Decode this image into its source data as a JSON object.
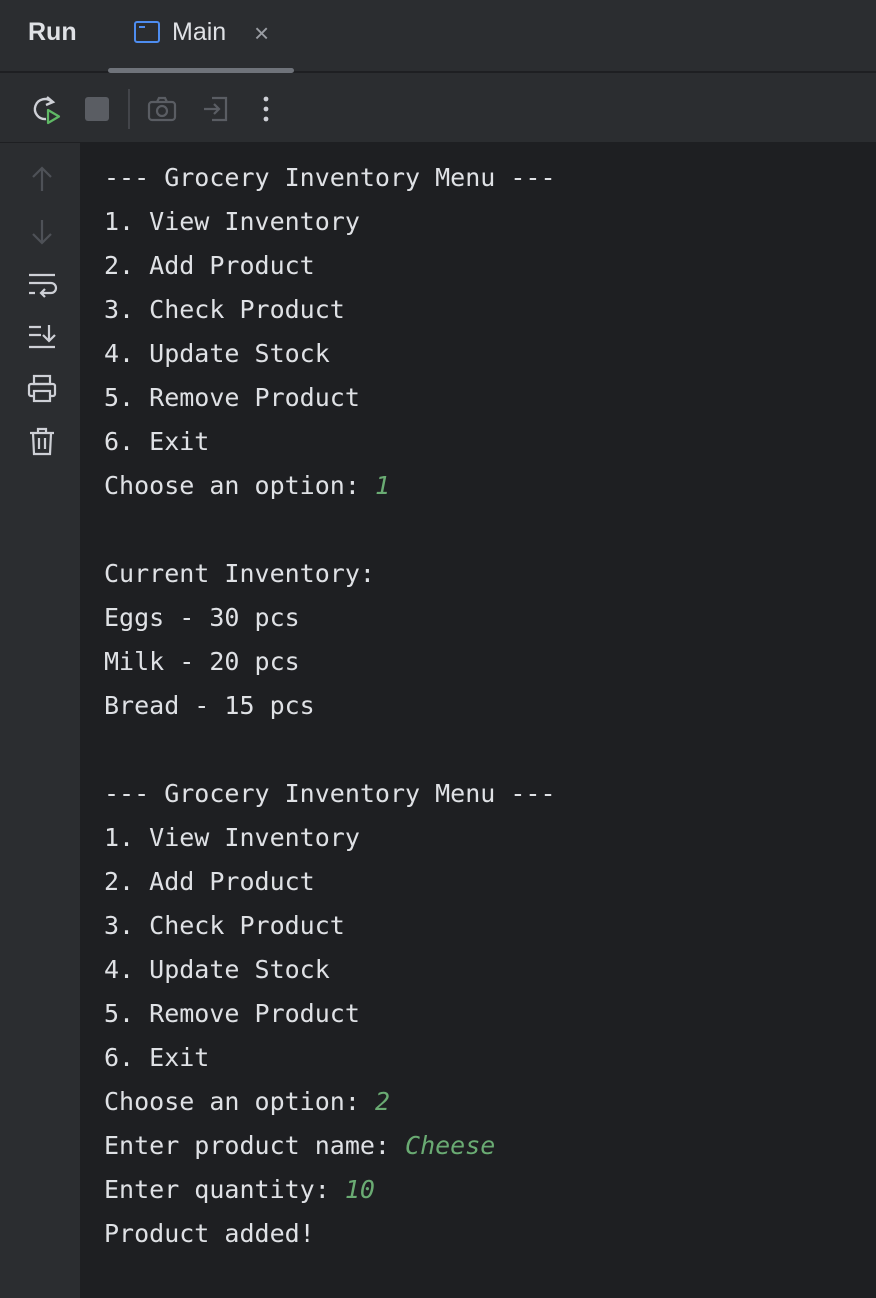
{
  "header": {
    "run_title": "Run",
    "tab_label": "Main",
    "tab_close": "×"
  },
  "toolbar": {
    "icons": [
      "rerun-icon",
      "stop-icon",
      "screenshot-icon",
      "export-icon",
      "more-icon"
    ]
  },
  "gutter": {
    "icons": [
      "up-arrow-icon",
      "down-arrow-icon",
      "soft-wrap-icon",
      "scroll-to-end-icon",
      "print-icon",
      "trash-icon"
    ]
  },
  "console": {
    "lines": [
      {
        "text": "--- Grocery Inventory Menu ---",
        "input": ""
      },
      {
        "text": "1. View Inventory",
        "input": ""
      },
      {
        "text": "2. Add Product",
        "input": ""
      },
      {
        "text": "3. Check Product",
        "input": ""
      },
      {
        "text": "4. Update Stock",
        "input": ""
      },
      {
        "text": "5. Remove Product",
        "input": ""
      },
      {
        "text": "6. Exit",
        "input": ""
      },
      {
        "text": "Choose an option: ",
        "input": "1"
      },
      {
        "text": "",
        "input": ""
      },
      {
        "text": "Current Inventory:",
        "input": ""
      },
      {
        "text": "Eggs - 30 pcs",
        "input": ""
      },
      {
        "text": "Milk - 20 pcs",
        "input": ""
      },
      {
        "text": "Bread - 15 pcs",
        "input": ""
      },
      {
        "text": "",
        "input": ""
      },
      {
        "text": "--- Grocery Inventory Menu ---",
        "input": ""
      },
      {
        "text": "1. View Inventory",
        "input": ""
      },
      {
        "text": "2. Add Product",
        "input": ""
      },
      {
        "text": "3. Check Product",
        "input": ""
      },
      {
        "text": "4. Update Stock",
        "input": ""
      },
      {
        "text": "5. Remove Product",
        "input": ""
      },
      {
        "text": "6. Exit",
        "input": ""
      },
      {
        "text": "Choose an option: ",
        "input": "2"
      },
      {
        "text": "Enter product name: ",
        "input": "Cheese"
      },
      {
        "text": "Enter quantity: ",
        "input": "10"
      },
      {
        "text": "Product added!",
        "input": ""
      }
    ]
  }
}
